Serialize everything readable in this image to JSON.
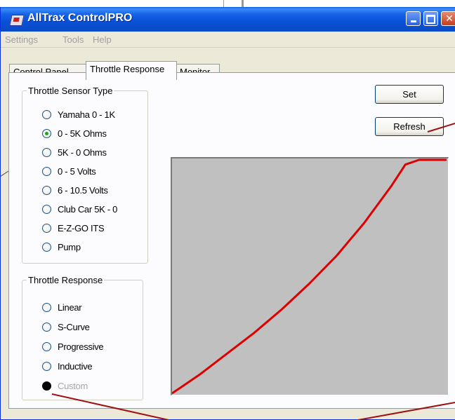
{
  "window": {
    "title": "AllTrax ControlPRO"
  },
  "menu": [
    "Settings",
    "Tools",
    "Help"
  ],
  "tabs": [
    {
      "label": "Control Panel",
      "active": false
    },
    {
      "label": "Throttle Response",
      "active": true
    },
    {
      "label": "Monitor",
      "active": false
    }
  ],
  "sensor_group": {
    "title": "Throttle Sensor Type",
    "options": [
      {
        "label": "Yamaha 0 - 1K",
        "checked": false
      },
      {
        "label": "0 - 5K Ohms",
        "checked": true
      },
      {
        "label": "5K - 0 Ohms",
        "checked": false
      },
      {
        "label": "0 - 5 Volts",
        "checked": false
      },
      {
        "label": "6 - 10.5 Volts",
        "checked": false
      },
      {
        "label": "Club Car 5K - 0",
        "checked": false
      },
      {
        "label": "E-Z-GO ITS",
        "checked": false
      },
      {
        "label": "Pump",
        "checked": false
      }
    ]
  },
  "response_group": {
    "title": "Throttle Response",
    "options": [
      {
        "label": "Linear",
        "checked": false
      },
      {
        "label": "S-Curve",
        "checked": false
      },
      {
        "label": "Progressive",
        "checked": false
      },
      {
        "label": "Inductive",
        "checked": false
      },
      {
        "label": "Custom",
        "checked": true,
        "disabled": true
      }
    ]
  },
  "buttons": {
    "set": "Set",
    "refresh": "Refresh"
  },
  "curve": {
    "color": "#dd0000",
    "background": "#c0c0c0",
    "x": [
      0,
      0.1,
      0.2,
      0.3,
      0.4,
      0.5,
      0.6,
      0.7,
      0.8,
      0.85,
      0.9,
      1.0
    ],
    "y": [
      0,
      0.08,
      0.17,
      0.26,
      0.36,
      0.47,
      0.59,
      0.73,
      0.89,
      0.98,
      1.0,
      1.0
    ]
  }
}
